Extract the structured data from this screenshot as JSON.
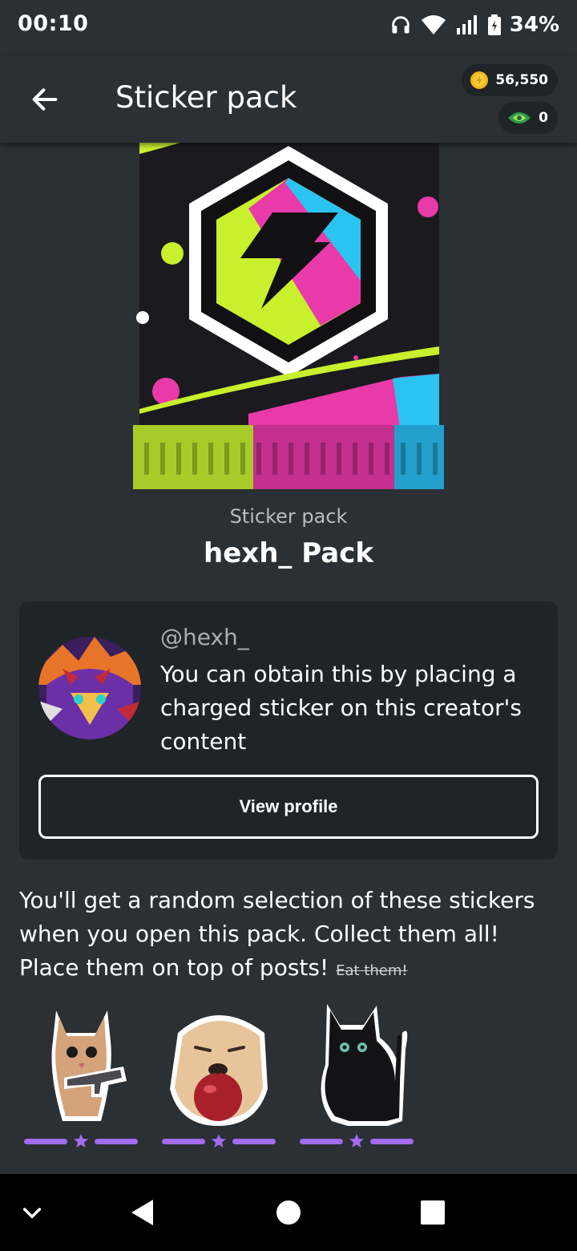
{
  "status_bar": {
    "time": "00:10",
    "battery": "34%"
  },
  "app_bar": {
    "title": "Sticker pack",
    "coins": "56,550",
    "gems": "0"
  },
  "pack": {
    "subtitle": "Sticker pack",
    "name": "hexh_ Pack"
  },
  "creator": {
    "handle": "@hexh_",
    "description": "You can obtain this by placing a charged sticker on this creator's content",
    "view_profile_label": "View profile"
  },
  "description": {
    "text": "You'll get a random selection of these stickers when you open this pack. Collect them all! Place them on top of posts!",
    "strike_text": "Eat them!"
  },
  "stickers": [
    {
      "icon": "kitten-with-gun-sticker"
    },
    {
      "icon": "dog-with-apple-sticker"
    },
    {
      "icon": "black-cat-sticker"
    }
  ],
  "colors": {
    "background": "#2a3033",
    "card": "#1f2527",
    "rarity": "#a26bf0",
    "pack_lime": "#c8f02c",
    "pack_magenta": "#e83aa8",
    "pack_cyan": "#2bc4f0"
  }
}
